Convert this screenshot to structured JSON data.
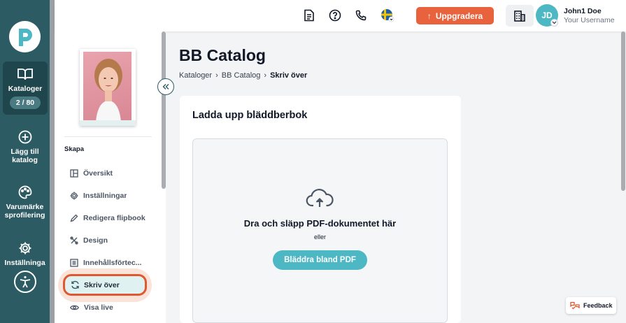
{
  "nav": {
    "items": [
      {
        "label": "Kataloger",
        "badge": "2 / 80",
        "icon": "book-open-icon",
        "active": true
      },
      {
        "label": "Lägg till katalog",
        "icon": "plus-circle-icon"
      },
      {
        "label": "Varumärke sprofilering",
        "icon": "palette-icon"
      },
      {
        "label": "Inställninga",
        "icon": "gear-icon"
      }
    ],
    "logo_icon": "brand-logo-icon",
    "accessibility_icon": "accessibility-icon"
  },
  "header": {
    "upgrade_label": "Uppgradera",
    "user_initials": "JD",
    "user_name": "John1 Doe",
    "user_subtitle": "Your Username",
    "icons": [
      "document-icon",
      "help-icon",
      "phone-icon",
      "flag-sweden-icon",
      "building-icon"
    ]
  },
  "sidebar": {
    "section_label": "Skapa",
    "items": [
      {
        "label": "Översikt",
        "icon": "layout-icon"
      },
      {
        "label": "Inställningar",
        "icon": "gear-icon"
      },
      {
        "label": "Redigera flipbook",
        "icon": "pencil-icon"
      },
      {
        "label": "Design",
        "icon": "design-icon"
      },
      {
        "label": "Innehållsförtec...",
        "icon": "list-icon"
      },
      {
        "label": "Skriv över",
        "icon": "refresh-icon",
        "active": true
      },
      {
        "label": "Visa live",
        "icon": "eye-icon"
      }
    ]
  },
  "main": {
    "title": "BB Catalog",
    "breadcrumb": [
      "Kataloger",
      "BB Catalog",
      "Skriv över"
    ],
    "card_title": "Ladda upp bläddberbok",
    "dropzone_title": "Dra och släpp PDF-dokumentet här",
    "dropzone_or": "eller",
    "browse_label": "Bläddra bland PDF"
  },
  "feedback_label": "Feedback",
  "colors": {
    "nav_bg": "#2d5b63",
    "accent_teal": "#4db8c4",
    "upgrade_orange": "#e8623e",
    "highlight_ring": "#e0582f"
  }
}
